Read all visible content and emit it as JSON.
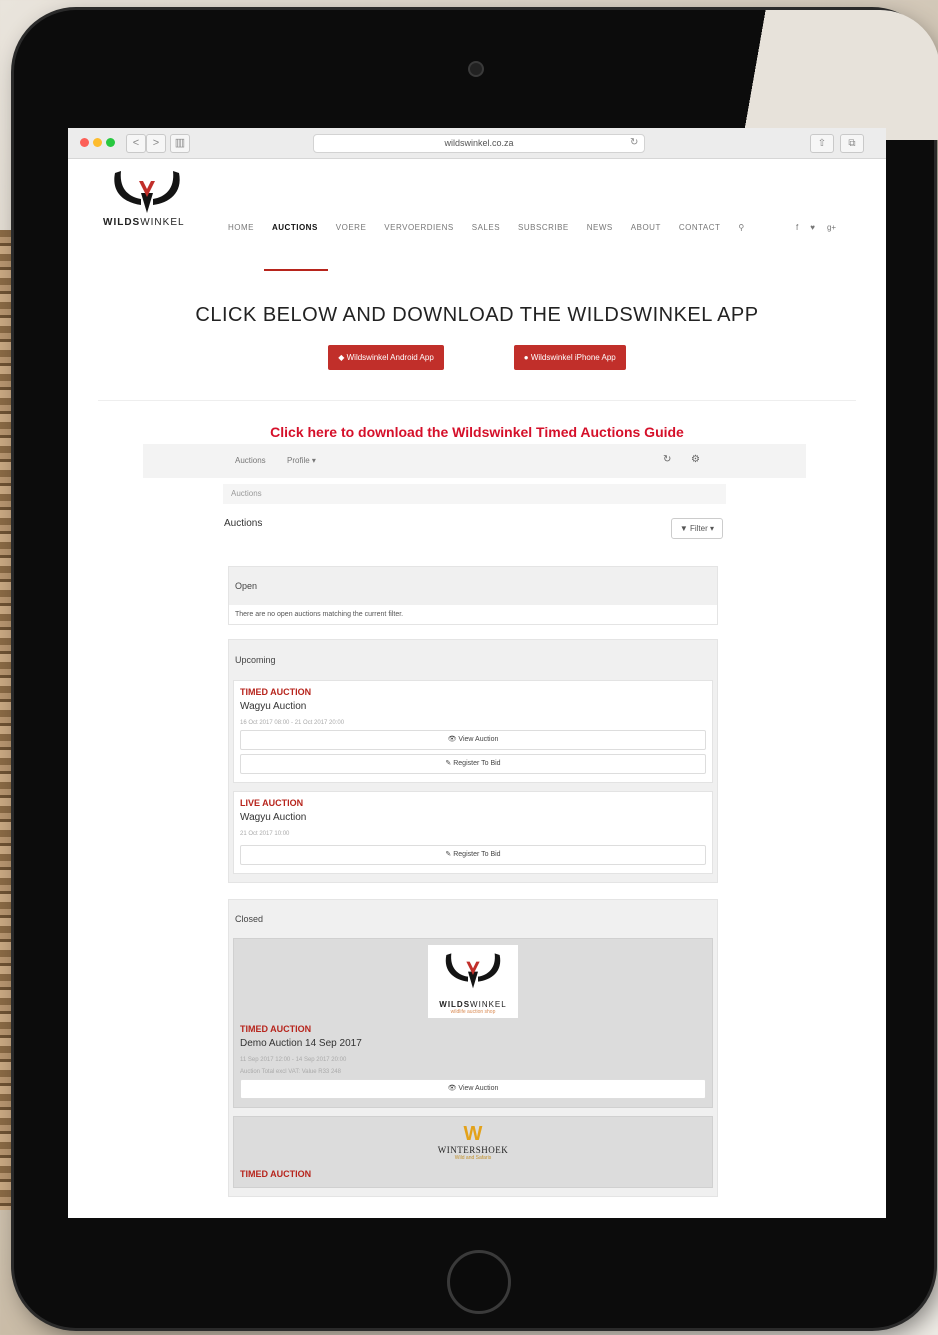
{
  "browser": {
    "url": "wildswinkel.co.za",
    "back_icon": "<",
    "forward_icon": ">",
    "sidebar_icon": "▥",
    "reload_icon": "↻",
    "share_icon": "⇧",
    "tabs_icon": "⧉"
  },
  "site": {
    "logo_text_bold": "WILDS",
    "logo_text_rest": "WINKEL",
    "menu": [
      {
        "label": "HOME"
      },
      {
        "label": "AUCTIONS"
      },
      {
        "label": "VOERE"
      },
      {
        "label": "VERVOERDIENS"
      },
      {
        "label": "SALES"
      },
      {
        "label": "SUBSCRIBE"
      },
      {
        "label": "NEWS"
      },
      {
        "label": "ABOUT"
      },
      {
        "label": "CONTACT"
      }
    ],
    "search_icon": "⚲",
    "social": [
      "f",
      "♥",
      "g+"
    ],
    "accent_color": "#c12f2a"
  },
  "promo": {
    "heading": "CLICK BELOW AND DOWNLOAD THE WILDSWINKEL APP",
    "android_button": "◆ Wildswinkel Android App",
    "iphone_button": "● Wildswinkel iPhone App"
  },
  "guide": {
    "link_text": "Click here to download the Wildswinkel Timed Auctions Guide",
    "link_color": "#d5102a"
  },
  "auction_app": {
    "toolbar_auctions": "Auctions",
    "toolbar_profile": "Profile ▾",
    "refresh_icon": "↻",
    "settings_icon": "⚙",
    "breadcrumb": "Auctions",
    "title": "Auctions",
    "filter_button": "▼ Filter ▾",
    "open": {
      "heading": "Open",
      "empty_text": "There are no open auctions matching the current filter."
    },
    "upcoming": {
      "heading": "Upcoming",
      "cards": [
        {
          "type": "TIMED AUCTION",
          "title": "Wagyu Auction",
          "date": "16 Oct 2017 08:00 - 21 Oct 2017 20:00",
          "view_button": "👁 View Auction",
          "register_button": "✎ Register To Bid"
        },
        {
          "type": "LIVE AUCTION",
          "title": "Wagyu Auction",
          "date": "21 Oct 2017 10:00",
          "register_button": "✎ Register To Bid"
        }
      ]
    },
    "closed": {
      "heading": "Closed",
      "cards": [
        {
          "logo_bold": "WILDS",
          "logo_rest": "WINKEL",
          "logo_sub": "wildlife auction shop",
          "type": "TIMED AUCTION",
          "title": "Demo Auction 14 Sep 2017",
          "date": "11 Sep 2017 12:00 - 14 Sep 2017 20:00",
          "total": "Auction Total excl VAT: Value R33 248",
          "view_button": "👁 View Auction"
        },
        {
          "logo_mark": "W",
          "logo_text": "WINTERSHOEK",
          "logo_sub": "Wild and Safaris",
          "type": "TIMED AUCTION"
        }
      ]
    }
  }
}
